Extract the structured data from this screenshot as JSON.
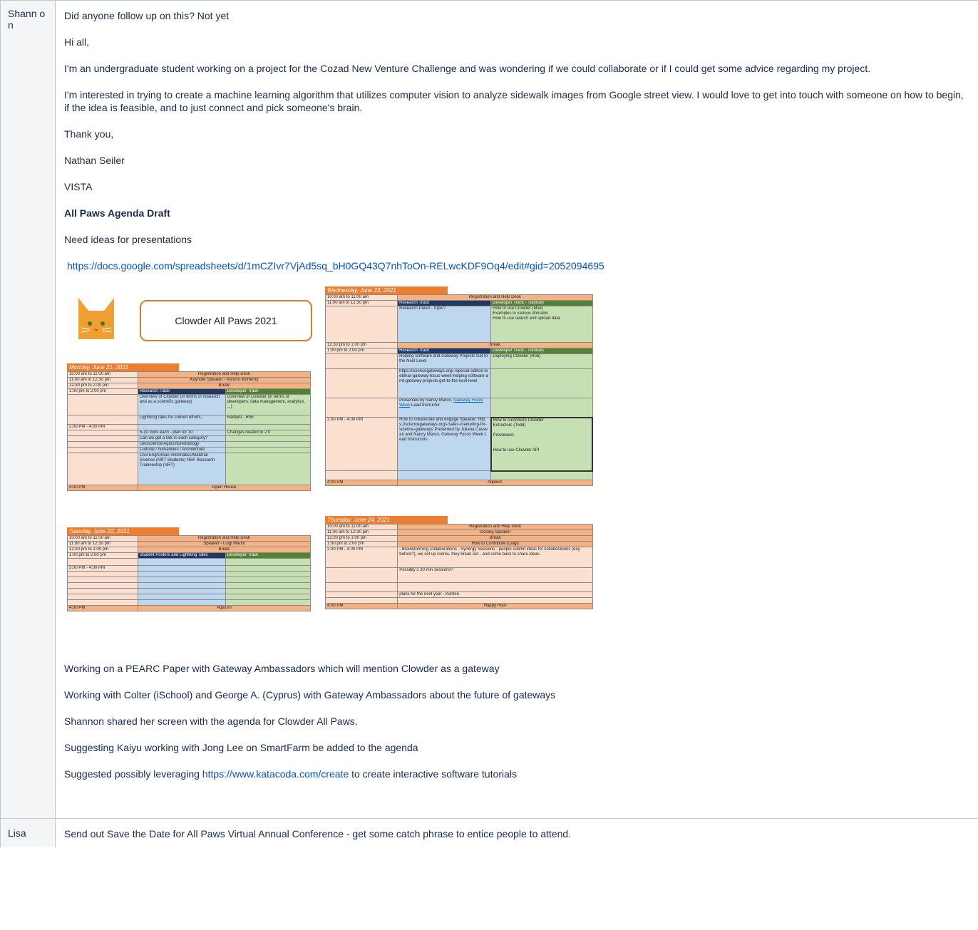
{
  "rows": [
    {
      "name": "Shann on",
      "paragraphs": [
        "Did anyone follow up on this? Not yet",
        "Hi all,",
        "I'm an undergraduate student working on a project for the Cozad New Venture Challenge and was wondering if we could collaborate or if I could get some advice regarding my project.",
        "I'm interested in trying to create a machine learning algorithm that utilizes computer vision to analyze sidewalk images from Google street view. I would love to get into touch with someone on how to begin, if the idea is feasible, and to just connect and pick someone's brain.",
        "Thank you,",
        "Nathan Seiler",
        "VISTA"
      ],
      "agenda_heading": "All Paws Agenda Draft",
      "agenda_note": "Need ideas for presentations",
      "sheet_link": "https://docs.google.com/spreadsheets/d/1mCZIvr7VjAd5sq_bH0GQ43Q7nhToOn-RELwcKDF9Oq4/edit#gid=2052094695",
      "after_image": [
        "Working on a PEARC Paper with Gateway Ambassadors which will mention Clowder as a gateway",
        "Working with Colter (iSchool) and George A. (Cyprus) with Gateway Ambassadors about the future of gateways",
        "Shannon shared her screen with the agenda for Clowder All Paws.",
        "Suggesting Kaiyu working with Jong Lee on SmartFarm be added to the agenda"
      ],
      "last_prefix": "Suggested possibly leveraging ",
      "last_link": "https://www.katacoda.com/create",
      "last_suffix": " to create interactive software tutorials"
    },
    {
      "name": "Lisa",
      "text": "Send out Save the Date for All Paws Virtual Annual Conference - get some catch phrase to entice people to attend."
    }
  ],
  "agenda_image": {
    "title": "Clowder All Paws 2021",
    "monday": {
      "header": "Monday, June 21, 2021",
      "r1": [
        "10:00 am to 11:00 am",
        "Registration and Help Desk"
      ],
      "r2": [
        "11:00 am to 12:30 pm",
        "Keynote Speaker - Kenton McHenry"
      ],
      "r3": [
        "12:30 pm to 2:00 pm",
        "Break"
      ],
      "r4": [
        "1:00 pm to 2:00 pm",
        "Research Track",
        "Developer Track"
      ],
      "r5": [
        "Overview of Clowder (in terms of research, and as a scientific gateway)",
        "Overview of Clowder (in terms of developers: data management, analytics, ...)"
      ],
      "r6": [
        "Lightning talks for current efforts,",
        "Radiant - Rob"
      ],
      "r7": "2:00 PM - 4:00 PM",
      "r8": [
        "5-10 mins each - plan for 10",
        "Changes related to 2.0"
      ],
      "r9": "Can we get a talk in each category?",
      "r10": "Geoscience/Agriculture/Biology",
      "r11": "Cultural / humanities / Architecture",
      "r12": "Civil Eng/Urban Informatics/Material Science (NRT Students) NSF Research Traineeship (NRT)",
      "r13": [
        "4:00 PM",
        "Open House"
      ]
    },
    "tuesday": {
      "header": "Tuesday, June 22, 2021",
      "r1": [
        "10:00 am to 11:00 am",
        "Registration and Help Desk"
      ],
      "r2": [
        "11:00 am to 12:30 pm",
        "Speaker - Luigi Marini"
      ],
      "r3": [
        "12:30 pm to 1:00 pm",
        "Break"
      ],
      "r4": [
        "1:00 pm to 2:00 pm",
        "Student Posters and Lightning Talks",
        "Developer Track"
      ],
      "r5": "2:00 PM - 4:00 PM",
      "r6": [
        "4:00 PM",
        "Adjourn"
      ]
    },
    "wednesday": {
      "header": "Wednesday, June 23, 2021",
      "r1": [
        "10:00 am to 11:00 am",
        "Registration and Help Desk"
      ],
      "r2": [
        "11:00 am to 12:30 pm",
        "Research Track",
        "Developer Track - Tutorials"
      ],
      "r3": [
        "Research Panel - Topic?",
        "How to use Clowder (Max)",
        "Examples in various domains",
        "How to use search and upload data"
      ],
      "r4": [
        "12:30 pm to 1:00 pm",
        "Break"
      ],
      "r5": [
        "1:00 pm to 2:00 pm",
        "Research Track",
        "Developer Track - Tutorials"
      ],
      "r6": [
        "Helping Software and Gateway Projects Get to the Next Level",
        "Deploying Clowder (Rob)"
      ],
      "r7": "https://sciencegateways.org/-/special-edition-webinar-gateway-focus-week-helping-software-and-gateway-projects-get-to-the-next-level",
      "r8a": "Presented by Nancy Maron,",
      "r8b": "Gateway Focus Week",
      "r8c": " Lead Instructor",
      "r9": [
        "2:00 PM - 4:00 PM",
        "How to collaborate and engage Speaker: https://sciencegateways.org/-/sales-marketing-for-science-gateways Presented by Juliana Casavan and Nancy Maron, Gateway Focus Week Lead Instructors"
      ],
      "r9b": [
        "How to customize Clowder",
        "Extractors (Todd)",
        "Previewers",
        "How to use Clowder API"
      ],
      "r10": [
        "4:00 PM",
        "Adjourn"
      ]
    },
    "thursday": {
      "header": "Thursday, June 24, 2021",
      "r1": [
        "10:00 am to 11:00 am",
        "Registration and Help Desk"
      ],
      "r2": [
        "11:00 am to 12:30 pm",
        "Closing Speaker"
      ],
      "r3": [
        "12:30 pm to 1:00 pm",
        "Break"
      ],
      "r4": [
        "1:00 pm to 2:00 pm",
        "How to Contribute (Luigi)"
      ],
      "r5": [
        "2:00 PM - 4:00 PM",
        "- Brainstorming Collaborations - Synergy Sessions - people submit ideas for collaborations (day before?), we set up rooms, they break out - and come back to share ideas"
      ],
      "r6": "Possibly 2 30 min sessions?",
      "r7": "plans for the next year - Kenton",
      "r8": [
        "4:00 PM",
        "Happy Hour"
      ]
    }
  }
}
